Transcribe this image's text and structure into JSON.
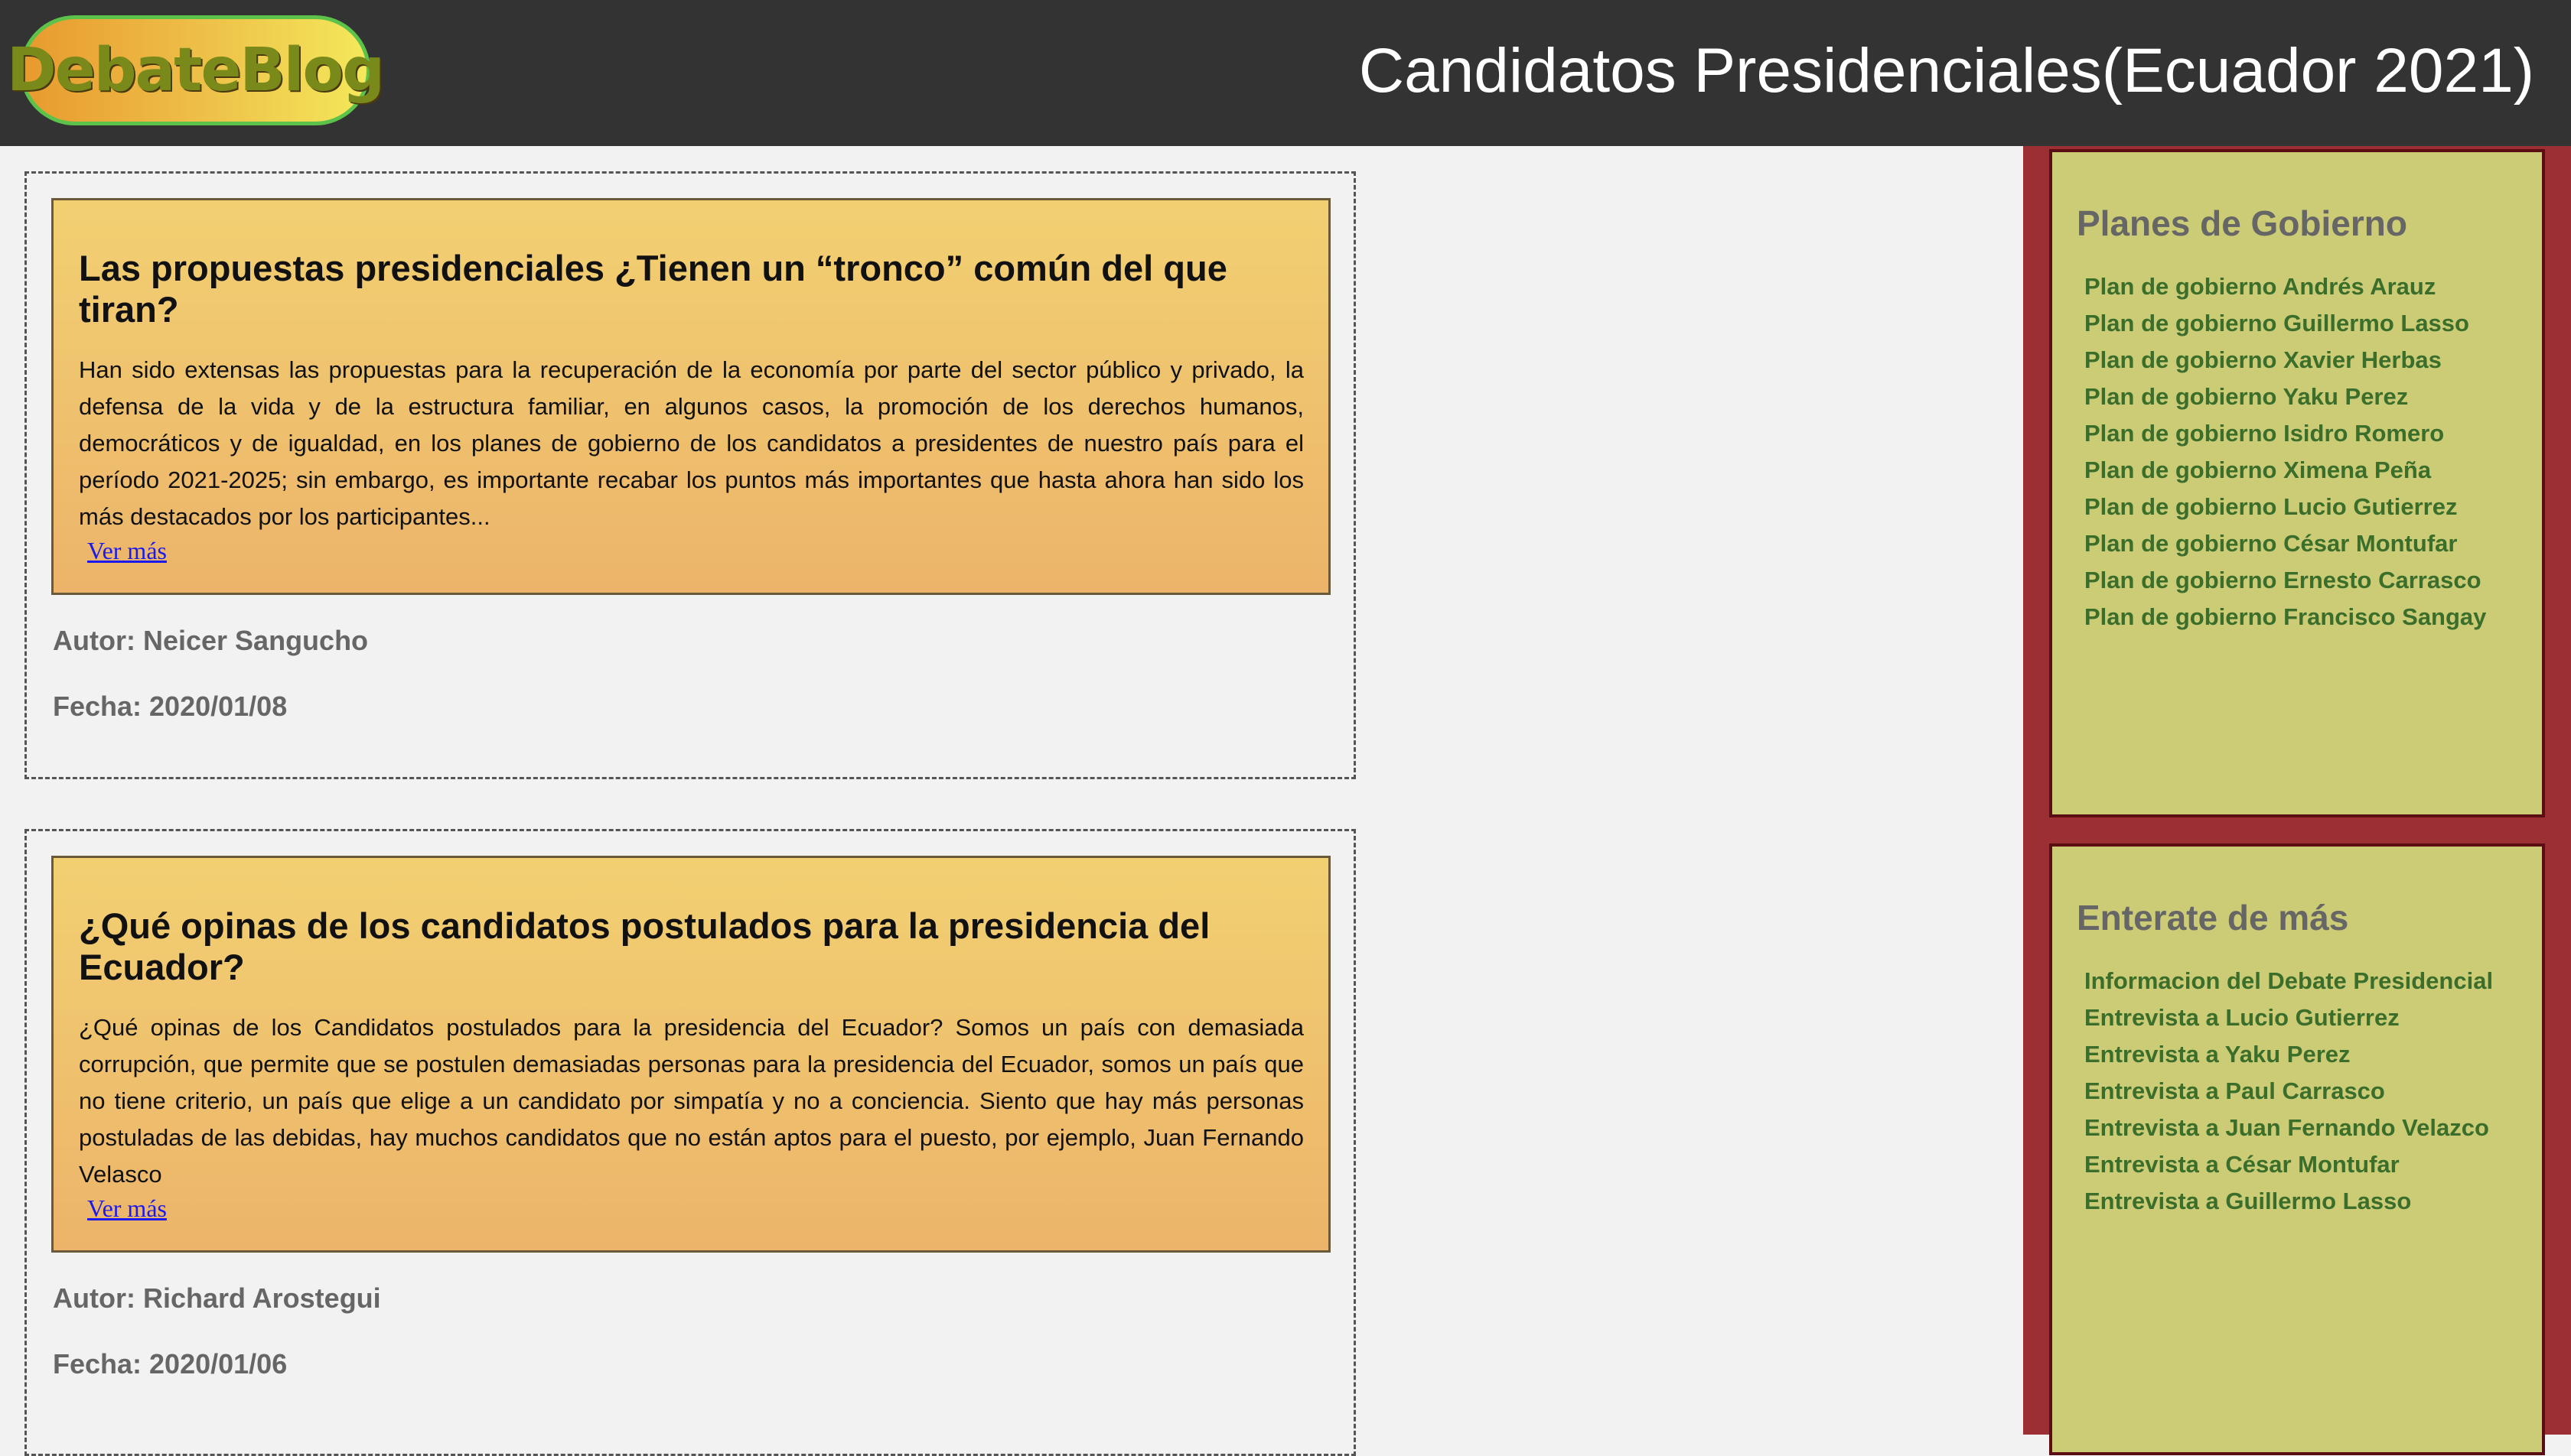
{
  "header": {
    "logo_text": "DebateBlog",
    "title": "Candidatos Presidenciales(Ecuador 2021)"
  },
  "articles": [
    {
      "title": "Las propuestas presidenciales ¿Tienen un “tronco” común del que tiran?",
      "body": "Han sido extensas las propuestas para la recuperación de la economía por parte del sector público y privado, la defensa de la vida y de la estructura familiar, en algunos casos, la promoción de los derechos humanos, democráticos y de igualdad, en los planes de gobierno de los candidatos a presidentes de nuestro país para el período 2021-2025; sin embargo, es importante recabar los puntos más importantes que hasta ahora han sido los más destacados por los participantes...",
      "more_label": "Ver más",
      "author": "Autor: Neicer Sangucho",
      "date": "Fecha: 2020/01/08"
    },
    {
      "title": "¿Qué opinas de los candidatos postulados para la presidencia del Ecuador?",
      "body": "¿Qué opinas de los Candidatos postulados para la presidencia del Ecuador? Somos un país con demasiada corrupción, que permite que se postulen demasiadas personas para la presidencia del Ecuador, somos un país que no tiene criterio, un país que elige a un candidato por simpatía y no a conciencia. Siento que hay más personas postuladas de las debidas, hay muchos candidatos que no están aptos para el puesto, por ejemplo, Juan Fernando Velasco",
      "more_label": "Ver más",
      "author": "Autor: Richard Arostegui",
      "date": "Fecha: 2020/01/06"
    }
  ],
  "sidebar": {
    "planes": {
      "title": "Planes de Gobierno",
      "items": [
        "Plan de gobierno Andrés Arauz",
        "Plan de gobierno Guillermo Lasso",
        "Plan de gobierno Xavier Herbas",
        "Plan de gobierno Yaku Perez",
        "Plan de gobierno Isidro Romero",
        "Plan de gobierno Ximena Peña",
        "Plan de gobierno Lucio Gutierrez",
        "Plan de gobierno César Montufar",
        "Plan de gobierno Ernesto Carrasco",
        "Plan de gobierno Francisco Sangay"
      ]
    },
    "enterate": {
      "title": "Enterate de más",
      "items": [
        "Informacion del Debate Presidencial",
        "Entrevista a Lucio Gutierrez",
        "Entrevista a Yaku Perez",
        "Entrevista a Paul Carrasco",
        "Entrevista a Juan Fernando Velazco",
        "Entrevista a César Montufar",
        "Entrevista a Guillermo Lasso"
      ]
    }
  },
  "colors": {
    "header_bg": "#333333",
    "card_gradient_top": "#f2d072",
    "card_gradient_bottom": "#ecb46a",
    "sidebar_bg": "#9c2f33",
    "panel_bg": "#cccc77",
    "link_green": "#3a6e2a",
    "link_blue": "#1a1aee"
  }
}
